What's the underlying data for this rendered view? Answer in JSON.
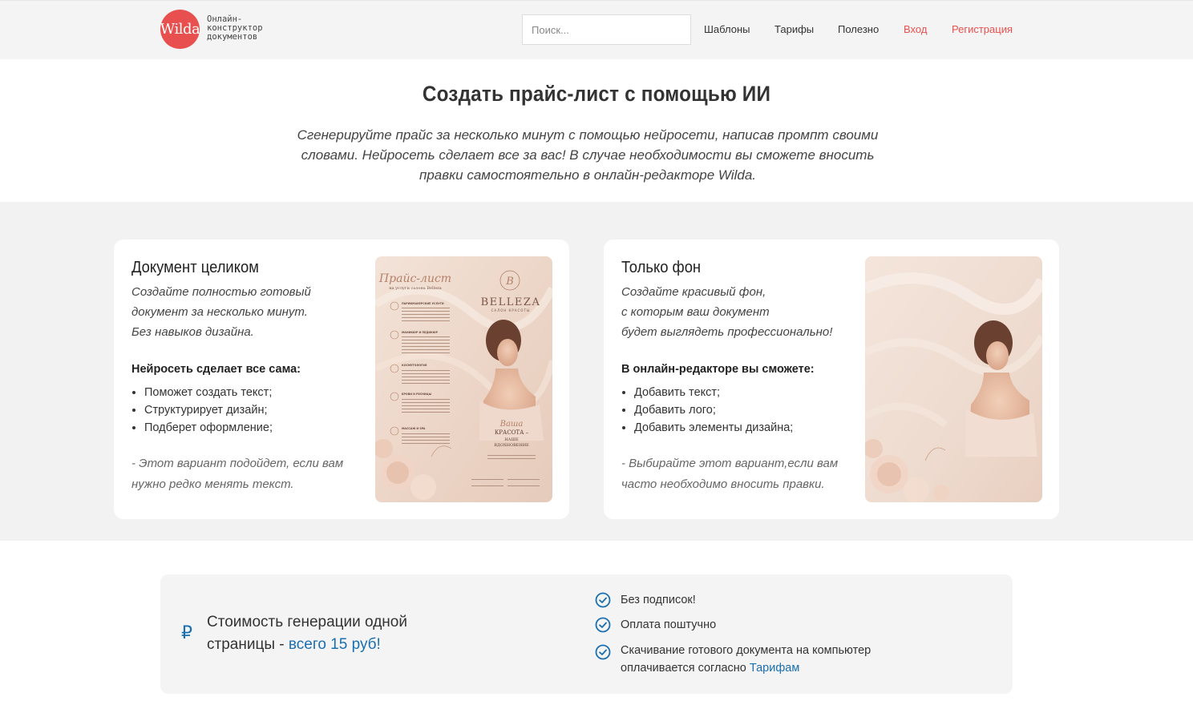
{
  "header": {
    "logo_text": "Wilda",
    "tagline": [
      "Онлайн-",
      "конструктор",
      "документов"
    ],
    "search_placeholder": "Поиск...",
    "nav": {
      "templates": "Шаблоны",
      "tariffs": "Тарифы",
      "useful": "Полезно",
      "login": "Вход",
      "register": "Регистрация"
    }
  },
  "hero": {
    "title": "Создать прайс-лист с помощью ИИ",
    "subtitle": "Сгенерируйте прайс за несколько минут с помощью нейросети, написав промпт своими словами. Нейросеть сделает все за вас! В случае необходимости вы сможете вносить правки самостоятельно в онлайн-редакторе Wilda."
  },
  "cards": [
    {
      "title": "Документ целиком",
      "intro": [
        "Создайте полностью готовый",
        "документ за несколько минут.",
        "Без навыков дизайна."
      ],
      "lead": "Нейросеть сделает все сама:",
      "items": [
        "Поможет создать текст;",
        "Структурирует дизайн;",
        "Подберет оформление;"
      ],
      "note": "- Этот вариант подойдет, если вам нужно редко менять текст.",
      "thumb": {
        "script_title": "Прайс-лист",
        "script_sub": "на услуги салона Belleza",
        "brand": "BELLEZA",
        "brand_sub": "САЛОН КРАСОТЫ",
        "monogram": "B",
        "slogan_script": "Ваша",
        "slogan": [
          "КРАСОТА –",
          "НАШЕ",
          "ВДОХНОВЕНИЕ"
        ],
        "sections": [
          "ПАРИКМАХЕРСКИЕ УСЛУГИ",
          "МАНИКЮР И ПЕДИКЮР",
          "КОСМЕТОЛОГИЯ",
          "БРОВИ И РЕСНИЦЫ",
          "МАССАЖ И SPA"
        ]
      }
    },
    {
      "title": "Только фон",
      "intro": [
        "Создайте красивый фон,",
        "с которым ваш документ",
        "будет выглядеть профессионально!"
      ],
      "lead": "В онлайн-редакторе вы сможете:",
      "items": [
        "Добавить текст;",
        "Добавить лого;",
        "Добавить элементы дизайна;"
      ],
      "note": "- Выбирайте этот вариант,если вам часто необходимо вносить правки."
    }
  ],
  "pricing": {
    "currency_symbol": "₽",
    "text_part1": "Стоимость генерации одной страницы - ",
    "text_highlight": "всего 15 руб!",
    "features": [
      "Без подписок!",
      "Оплата поштучно",
      "Скачивание готового документа на компьютер оплачивается согласно "
    ],
    "tariffs_link": "Тарифам"
  },
  "colors": {
    "brand_red": "#e8504f",
    "link_blue": "#1a6fb0",
    "band_grey": "#f2f2f2"
  }
}
